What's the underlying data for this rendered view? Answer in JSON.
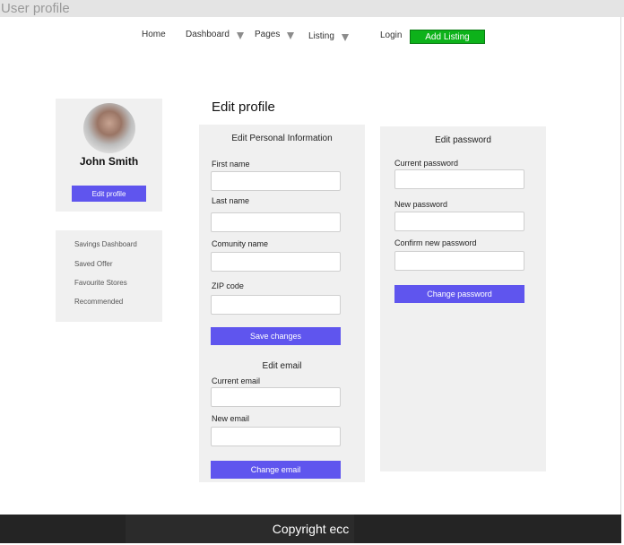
{
  "window": {
    "title": "User profile"
  },
  "nav": {
    "home": "Home",
    "dashboard": "Dashboard",
    "pages": "Pages",
    "listing": "Listing",
    "login": "Login",
    "add_listing": "Add Listing"
  },
  "user": {
    "name": "John Smith",
    "edit_profile": "Edit profile"
  },
  "menu": [
    "Savings Dashboard",
    "Saved Offer",
    "Favourite Stores",
    "Recommended"
  ],
  "page_title": "Edit profile",
  "personal": {
    "title": "Edit Personal Information",
    "first_name": "First name",
    "last_name": "Last name",
    "community": "Comunity name",
    "zip": "ZIP code",
    "save": "Save changes"
  },
  "email": {
    "title": "Edit email",
    "current": "Current email",
    "new": "New email",
    "change": "Change email"
  },
  "password": {
    "title": "Edit password",
    "current": "Current password",
    "new": "New password",
    "confirm": "Confirm new password",
    "change": "Change password"
  },
  "footer": {
    "copyright": "Copyright ecc"
  },
  "colors": {
    "primary": "#5f55ee",
    "accent_green": "#0db21a",
    "footer_bg": "#242424",
    "panel_bg": "#f0f0f0"
  }
}
